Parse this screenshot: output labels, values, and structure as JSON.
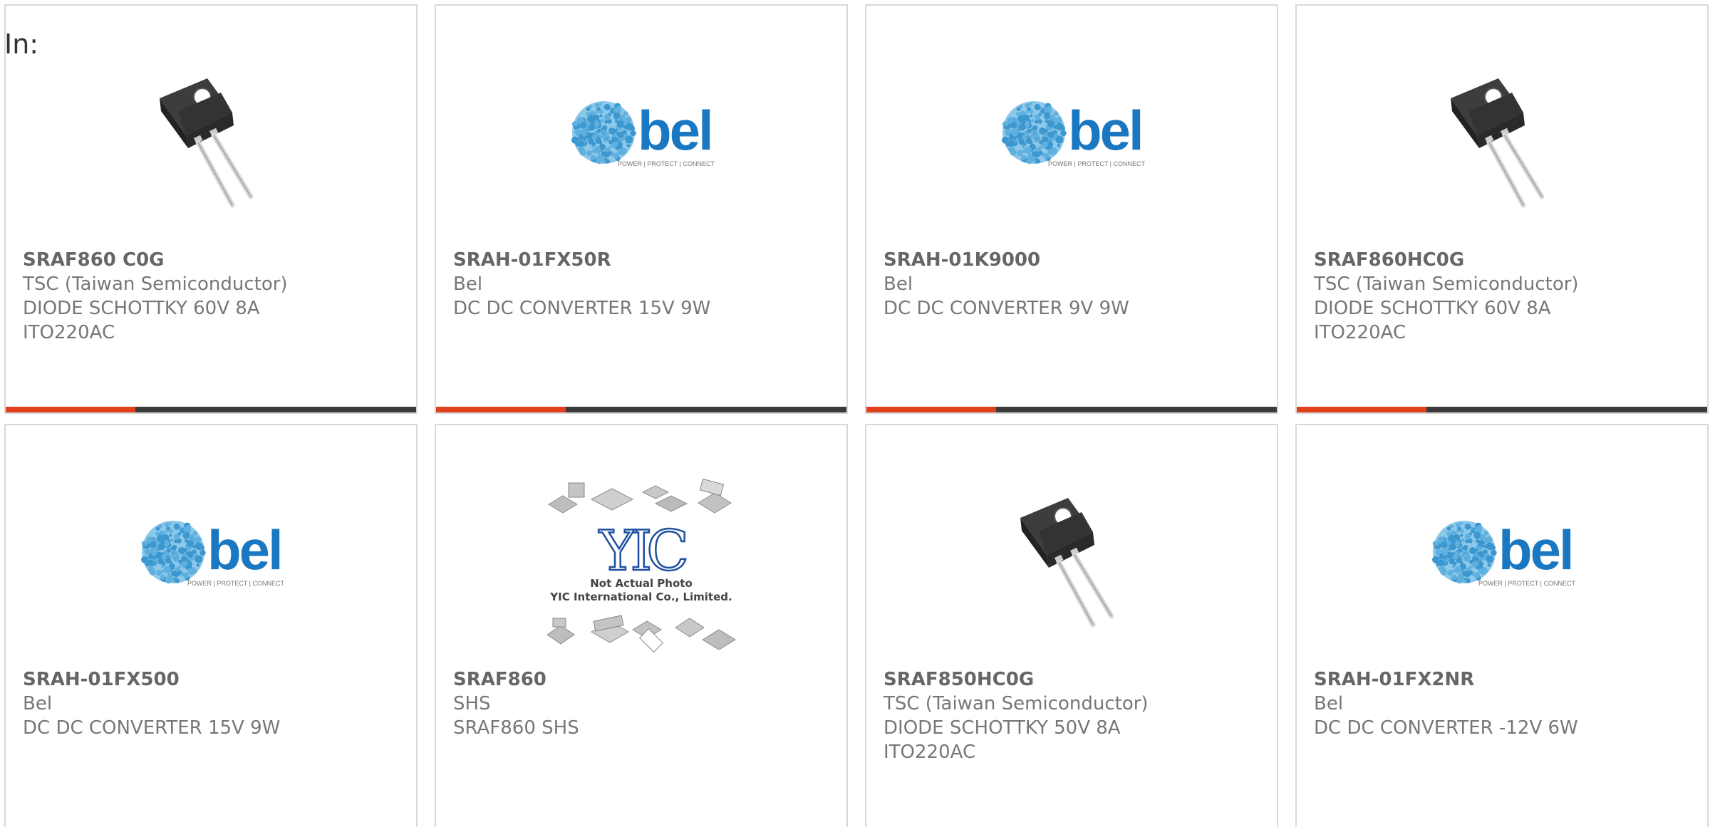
{
  "header": {
    "label": "In:"
  },
  "colors": {
    "accent": "#e0401a",
    "bar": "#3a3a3a",
    "bel_blue": "#1a78c2"
  },
  "cards": [
    {
      "part": "SRAF860 C0G",
      "maker": "TSC (Taiwan Semiconductor)",
      "desc": "DIODE SCHOTTKY 60V 8A",
      "desc2": "ITO220AC",
      "image": "to220-diode"
    },
    {
      "part": "SRAH-01FX50R",
      "maker": "Bel",
      "desc": "DC DC CONVERTER 15V 9W",
      "desc2": "",
      "image": "bel-logo"
    },
    {
      "part": "SRAH-01K9000",
      "maker": "Bel",
      "desc": "DC DC CONVERTER 9V 9W",
      "desc2": "",
      "image": "bel-logo"
    },
    {
      "part": "SRAF860HC0G",
      "maker": "TSC (Taiwan Semiconductor)",
      "desc": "DIODE SCHOTTKY 60V 8A",
      "desc2": "ITO220AC",
      "image": "to220-diode"
    },
    {
      "part": "SRAH-01FX500",
      "maker": "Bel",
      "desc": "DC DC CONVERTER 15V 9W",
      "desc2": "",
      "image": "bel-logo"
    },
    {
      "part": "SRAF860",
      "maker": "SHS",
      "desc": "SRAF860 SHS",
      "desc2": "",
      "image": "yic-placeholder"
    },
    {
      "part": "SRAF850HC0G",
      "maker": "TSC (Taiwan Semiconductor)",
      "desc": "DIODE SCHOTTKY 50V 8A",
      "desc2": "ITO220AC",
      "image": "to220-diode"
    },
    {
      "part": "SRAH-01FX2NR",
      "maker": "Bel",
      "desc": "DC DC CONVERTER -12V 6W",
      "desc2": "",
      "image": "bel-logo"
    }
  ],
  "logos": {
    "bel_word": "bel",
    "bel_tagline": "POWER | PROTECT | CONNECT",
    "yic_mark": "YIC",
    "yic_line1": "Not Actual Photo",
    "yic_line2": "YIC International Co., Limited."
  }
}
